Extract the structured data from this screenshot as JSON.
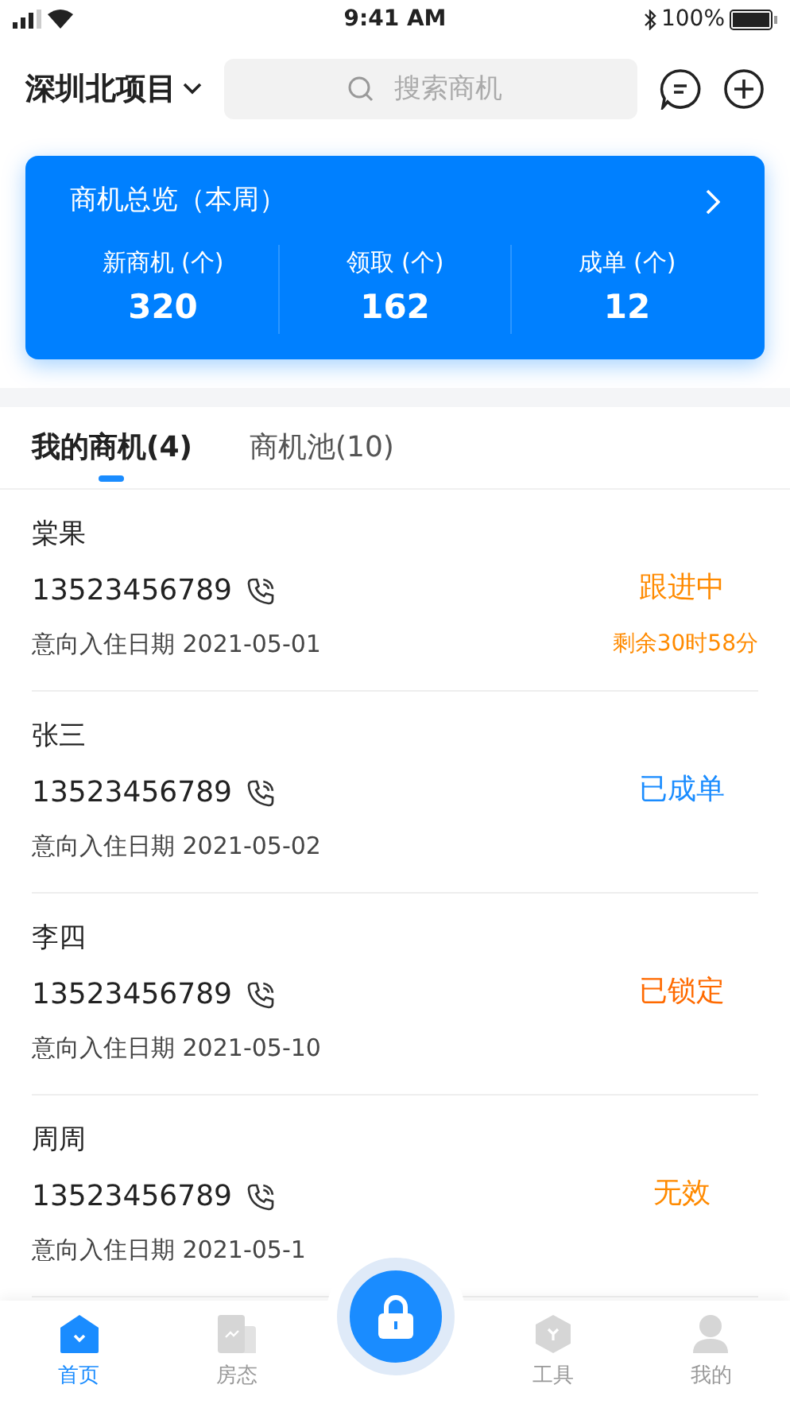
{
  "status_bar": {
    "time": "9:41 AM",
    "battery": "100%"
  },
  "header": {
    "project": "深圳北项目",
    "search": {
      "placeholder": "搜索商机"
    }
  },
  "overview": {
    "title": "商机总览（本周）",
    "stats": [
      {
        "label": "新商机 (个)",
        "value": "320"
      },
      {
        "label": "领取 (个)",
        "value": "162"
      },
      {
        "label": "成单 (个)",
        "value": "12"
      }
    ]
  },
  "tabs": [
    {
      "label": "我的商机(4)",
      "selected": true
    },
    {
      "label": "商机池(10)",
      "selected": false
    }
  ],
  "leads": [
    {
      "name": "棠果",
      "phone": "13523456789",
      "date": "意向入住日期 2021-05-01",
      "status": "跟进中",
      "color": "#ff8a00",
      "countdown": "剩余30时58分"
    },
    {
      "name": "张三",
      "phone": "13523456789",
      "date": "意向入住日期 2021-05-02",
      "status": "已成单",
      "color": "#1a8cff"
    },
    {
      "name": "李四",
      "phone": "13523456789",
      "date": "意向入住日期 2021-05-10",
      "status": "已锁定",
      "color": "#ff6a00"
    },
    {
      "name": "周周",
      "phone": "13523456789",
      "date": "意向入住日期 2021-05-1",
      "status": "无效",
      "color": "#ff8a00"
    }
  ],
  "bottom_nav": [
    {
      "label": "首页",
      "kind": "home",
      "selected": true
    },
    {
      "label": "房态",
      "kind": "rooms",
      "selected": false
    },
    {
      "kind": "lock",
      "selected": false
    },
    {
      "label": "工具",
      "kind": "tools",
      "selected": false
    },
    {
      "label": "我的",
      "kind": "me",
      "selected": false
    }
  ]
}
